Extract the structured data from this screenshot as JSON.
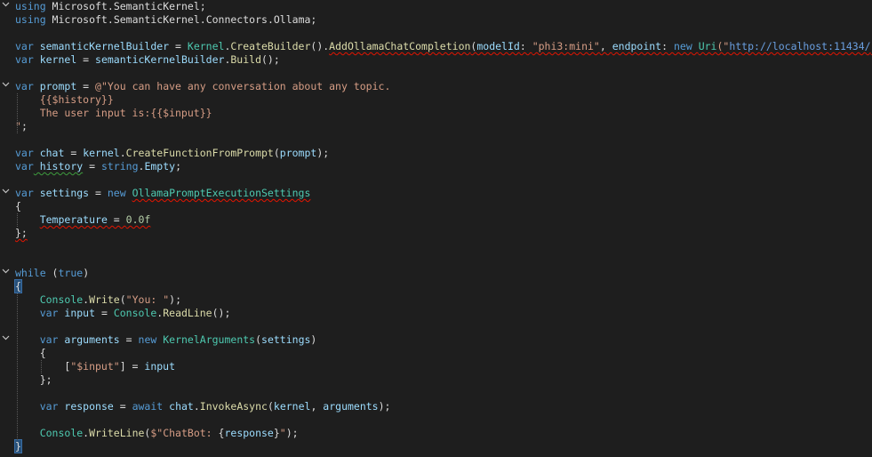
{
  "editor": {
    "fold_icon": "chevron-down",
    "colors": {
      "background": "#1e1e1e",
      "keyword": "#569cd6",
      "type": "#4ec9b0",
      "method": "#dcdcaa",
      "variable": "#9cdcfe",
      "string": "#d69d85",
      "number": "#b5cea8",
      "error_squiggle": "#e51400"
    },
    "lines": [
      {
        "tokens": [
          {
            "t": "using",
            "c": "kw"
          },
          {
            "t": " Microsoft",
            "c": "pl"
          },
          {
            "t": ".",
            "c": "pl"
          },
          {
            "t": "SemanticKernel",
            "c": "pl"
          },
          {
            "t": ";",
            "c": "pl"
          }
        ]
      },
      {
        "tokens": [
          {
            "t": "using",
            "c": "kw"
          },
          {
            "t": " Microsoft",
            "c": "pl"
          },
          {
            "t": ".",
            "c": "pl"
          },
          {
            "t": "SemanticKernel",
            "c": "pl"
          },
          {
            "t": ".",
            "c": "pl"
          },
          {
            "t": "Connectors",
            "c": "pl"
          },
          {
            "t": ".",
            "c": "pl"
          },
          {
            "t": "Ollama",
            "c": "pl"
          },
          {
            "t": ";",
            "c": "pl"
          }
        ]
      },
      {
        "tokens": []
      },
      {
        "tokens": [
          {
            "t": "var",
            "c": "kw"
          },
          {
            "t": " semanticKernelBuilder",
            "c": "vr"
          },
          {
            "t": " = ",
            "c": "pl"
          },
          {
            "t": "Kernel",
            "c": "ty"
          },
          {
            "t": ".",
            "c": "pl"
          },
          {
            "t": "CreateBuilder",
            "c": "fn"
          },
          {
            "t": "().",
            "c": "pl"
          },
          {
            "t": "AddOllamaChatCompletion",
            "c": "fn",
            "sq": true
          },
          {
            "t": "(",
            "c": "pl",
            "sq": true
          },
          {
            "t": "modelId",
            "c": "vr",
            "sq": true
          },
          {
            "t": ": ",
            "c": "pl",
            "sq": true
          },
          {
            "t": "\"phi3:mini\"",
            "c": "st",
            "sq": true
          },
          {
            "t": ", ",
            "c": "pl",
            "sq": true
          },
          {
            "t": "endpoint",
            "c": "vr",
            "sq": true
          },
          {
            "t": ": ",
            "c": "pl",
            "sq": true
          },
          {
            "t": "new",
            "c": "kw",
            "sq": true
          },
          {
            "t": " ",
            "c": "pl",
            "sq": true
          },
          {
            "t": "Uri",
            "c": "ty",
            "sq": true
          },
          {
            "t": "(\"",
            "c": "st",
            "sq": true
          },
          {
            "t": "http://localhost:11434/",
            "c": "link",
            "sq": true
          },
          {
            "t": "\"",
            "c": "st",
            "sq": true
          },
          {
            "t": "));",
            "c": "pl",
            "sq": true
          }
        ]
      },
      {
        "tokens": [
          {
            "t": "var",
            "c": "kw"
          },
          {
            "t": " kernel",
            "c": "vr"
          },
          {
            "t": " = ",
            "c": "pl"
          },
          {
            "t": "semanticKernelBuilder",
            "c": "vr"
          },
          {
            "t": ".",
            "c": "pl"
          },
          {
            "t": "Build",
            "c": "fn"
          },
          {
            "t": "();",
            "c": "pl"
          }
        ]
      },
      {
        "tokens": []
      },
      {
        "fold": true,
        "tokens": [
          {
            "t": "var",
            "c": "kw"
          },
          {
            "t": " prompt",
            "c": "vr"
          },
          {
            "t": " = ",
            "c": "pl"
          },
          {
            "t": "@\"You can have any conversation about any topic.",
            "c": "st"
          }
        ]
      },
      {
        "tokens": [
          {
            "t": "    {{$history}}",
            "c": "st"
          }
        ]
      },
      {
        "tokens": [
          {
            "t": "    The user input is:{{$input}}",
            "c": "st"
          }
        ]
      },
      {
        "tokens": [
          {
            "t": "\"",
            "c": "st"
          },
          {
            "t": ";",
            "c": "pl"
          }
        ]
      },
      {
        "tokens": []
      },
      {
        "tokens": [
          {
            "t": "var",
            "c": "kw"
          },
          {
            "t": " chat",
            "c": "vr"
          },
          {
            "t": " = ",
            "c": "pl"
          },
          {
            "t": "kernel",
            "c": "vr"
          },
          {
            "t": ".",
            "c": "pl"
          },
          {
            "t": "CreateFunctionFromPrompt",
            "c": "fn"
          },
          {
            "t": "(",
            "c": "pl"
          },
          {
            "t": "prompt",
            "c": "vr"
          },
          {
            "t": ");",
            "c": "pl"
          }
        ]
      },
      {
        "tokens": [
          {
            "t": "var",
            "c": "kw"
          },
          {
            "t": " history",
            "c": "vr",
            "green": true
          },
          {
            "t": " = ",
            "c": "pl"
          },
          {
            "t": "string",
            "c": "kw"
          },
          {
            "t": ".",
            "c": "pl"
          },
          {
            "t": "Empty",
            "c": "vr"
          },
          {
            "t": ";",
            "c": "pl"
          }
        ]
      },
      {
        "tokens": []
      },
      {
        "fold": true,
        "tokens": [
          {
            "t": "var",
            "c": "kw"
          },
          {
            "t": " settings",
            "c": "vr"
          },
          {
            "t": " = ",
            "c": "pl"
          },
          {
            "t": "new",
            "c": "kw"
          },
          {
            "t": " ",
            "c": "pl"
          },
          {
            "t": "OllamaPromptExecutionSettings",
            "c": "ty",
            "sq": true
          }
        ]
      },
      {
        "tokens": [
          {
            "t": "{",
            "c": "pl"
          }
        ]
      },
      {
        "tokens": [
          {
            "t": "    ",
            "c": "pl"
          },
          {
            "t": "Temperature",
            "c": "vr",
            "sq": true
          },
          {
            "t": " = ",
            "c": "pl",
            "sq": true
          },
          {
            "t": "0.0f",
            "c": "nu",
            "sq": true
          }
        ]
      },
      {
        "tokens": [
          {
            "t": "};",
            "c": "pl",
            "sq": true
          }
        ]
      },
      {
        "tokens": []
      },
      {
        "tokens": []
      },
      {
        "fold": true,
        "tokens": [
          {
            "t": "while",
            "c": "kw"
          },
          {
            "t": " (",
            "c": "pl"
          },
          {
            "t": "true",
            "c": "kw"
          },
          {
            "t": ")",
            "c": "pl"
          }
        ]
      },
      {
        "tokens": [
          {
            "t": "{",
            "c": "pl",
            "brace": true
          }
        ]
      },
      {
        "tokens": [
          {
            "t": "    ",
            "c": "pl"
          },
          {
            "t": "Console",
            "c": "ty"
          },
          {
            "t": ".",
            "c": "pl"
          },
          {
            "t": "Write",
            "c": "fn"
          },
          {
            "t": "(",
            "c": "pl"
          },
          {
            "t": "\"You: \"",
            "c": "st"
          },
          {
            "t": ");",
            "c": "pl"
          }
        ]
      },
      {
        "tokens": [
          {
            "t": "    ",
            "c": "pl"
          },
          {
            "t": "var",
            "c": "kw"
          },
          {
            "t": " input",
            "c": "vr"
          },
          {
            "t": " = ",
            "c": "pl"
          },
          {
            "t": "Console",
            "c": "ty"
          },
          {
            "t": ".",
            "c": "pl"
          },
          {
            "t": "ReadLine",
            "c": "fn"
          },
          {
            "t": "();",
            "c": "pl"
          }
        ]
      },
      {
        "tokens": []
      },
      {
        "fold": true,
        "tokens": [
          {
            "t": "    ",
            "c": "pl"
          },
          {
            "t": "var",
            "c": "kw"
          },
          {
            "t": " arguments",
            "c": "vr"
          },
          {
            "t": " = ",
            "c": "pl"
          },
          {
            "t": "new",
            "c": "kw"
          },
          {
            "t": " ",
            "c": "pl"
          },
          {
            "t": "KernelArguments",
            "c": "ty"
          },
          {
            "t": "(",
            "c": "pl"
          },
          {
            "t": "settings",
            "c": "vr"
          },
          {
            "t": ")",
            "c": "pl"
          }
        ]
      },
      {
        "tokens": [
          {
            "t": "    {",
            "c": "pl"
          }
        ]
      },
      {
        "tokens": [
          {
            "t": "        [",
            "c": "pl"
          },
          {
            "t": "\"$input\"",
            "c": "st"
          },
          {
            "t": "] = ",
            "c": "pl"
          },
          {
            "t": "input",
            "c": "vr"
          }
        ]
      },
      {
        "tokens": [
          {
            "t": "    };",
            "c": "pl"
          }
        ]
      },
      {
        "tokens": []
      },
      {
        "tokens": [
          {
            "t": "    ",
            "c": "pl"
          },
          {
            "t": "var",
            "c": "kw"
          },
          {
            "t": " response",
            "c": "vr"
          },
          {
            "t": " = ",
            "c": "pl"
          },
          {
            "t": "await",
            "c": "kw"
          },
          {
            "t": " ",
            "c": "pl"
          },
          {
            "t": "chat",
            "c": "vr"
          },
          {
            "t": ".",
            "c": "pl"
          },
          {
            "t": "InvokeAsync",
            "c": "fn"
          },
          {
            "t": "(",
            "c": "pl"
          },
          {
            "t": "kernel",
            "c": "vr"
          },
          {
            "t": ", ",
            "c": "pl"
          },
          {
            "t": "arguments",
            "c": "vr"
          },
          {
            "t": ");",
            "c": "pl"
          }
        ]
      },
      {
        "tokens": []
      },
      {
        "tokens": [
          {
            "t": "    ",
            "c": "pl"
          },
          {
            "t": "Console",
            "c": "ty"
          },
          {
            "t": ".",
            "c": "pl"
          },
          {
            "t": "WriteLine",
            "c": "fn"
          },
          {
            "t": "(",
            "c": "pl"
          },
          {
            "t": "$\"ChatBot: ",
            "c": "st"
          },
          {
            "t": "{",
            "c": "pl"
          },
          {
            "t": "response",
            "c": "vr"
          },
          {
            "t": "}",
            "c": "pl"
          },
          {
            "t": "\"",
            "c": "st"
          },
          {
            "t": ");",
            "c": "pl"
          }
        ]
      },
      {
        "tokens": [
          {
            "t": "}",
            "c": "pl",
            "brace": true
          }
        ]
      }
    ]
  }
}
